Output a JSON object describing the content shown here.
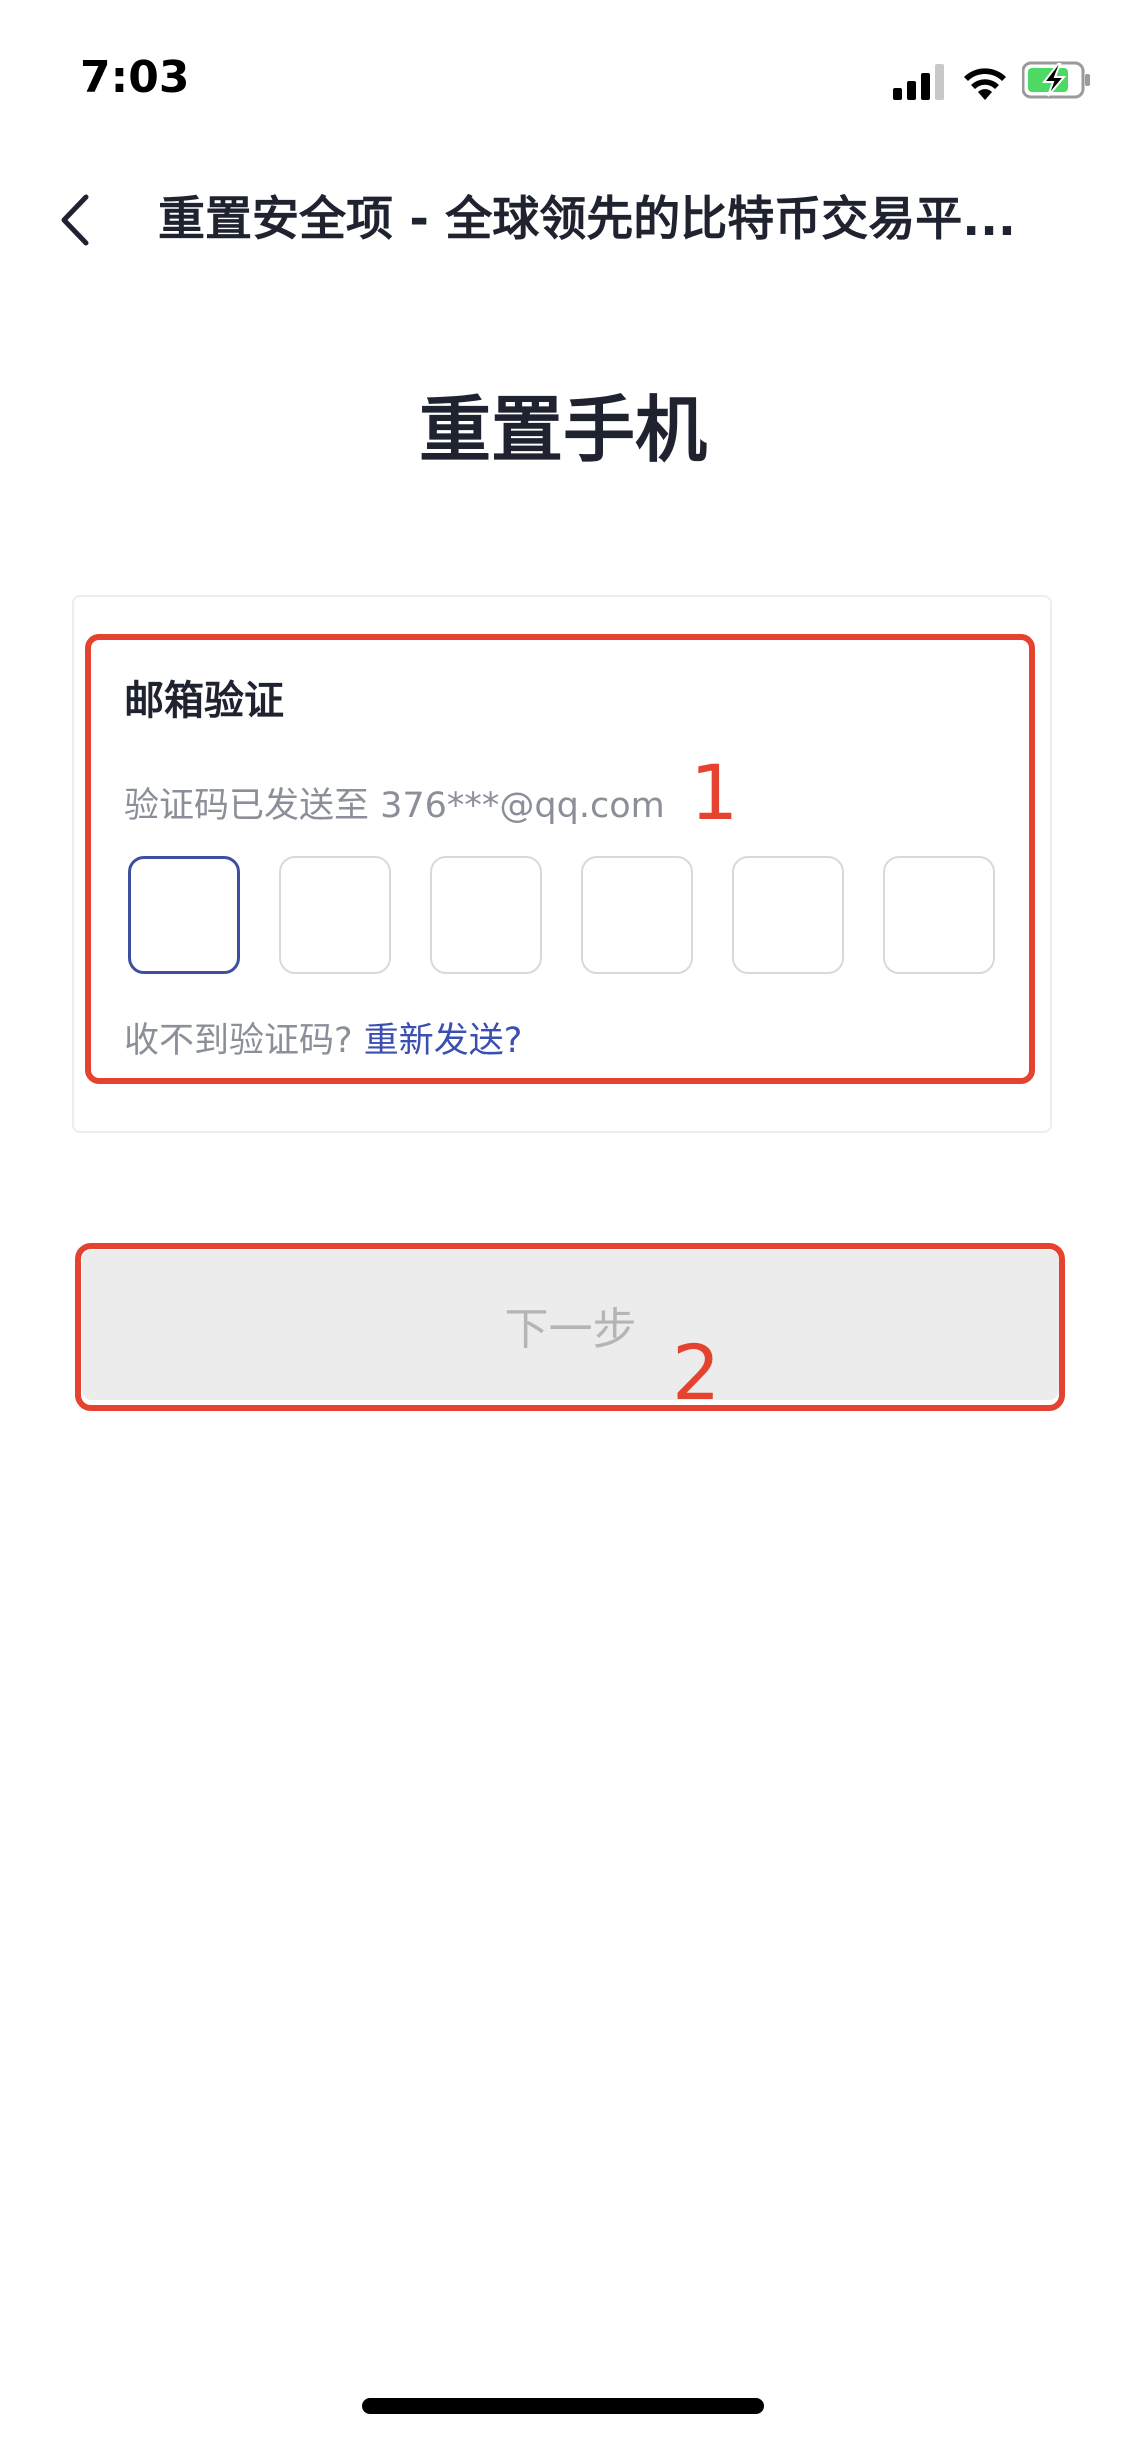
{
  "status_bar": {
    "time": "7:03",
    "icons": [
      "signal-icon",
      "wifi-icon",
      "battery-charging-icon"
    ]
  },
  "nav": {
    "title": "重置安全项 - 全球领先的比特币交易平...",
    "back_icon": "chevron-left-icon"
  },
  "page": {
    "title": "重置手机"
  },
  "email_verification": {
    "heading": "邮箱验证",
    "sent_to": "验证码已发送至 376***@qq.com",
    "code_boxes": [
      "",
      "",
      "",
      "",
      "",
      ""
    ],
    "no_code_text": "收不到验证码?",
    "resend_link": "重新发送?"
  },
  "next_button": {
    "label": "下一步",
    "enabled": false
  },
  "annotations": {
    "marker_1": "1",
    "marker_2": "2"
  },
  "colors": {
    "highlight": "#e5432f",
    "link": "#3b4fb0",
    "active_box_border": "#3f4fa0",
    "disabled_button_bg": "#ececec"
  }
}
